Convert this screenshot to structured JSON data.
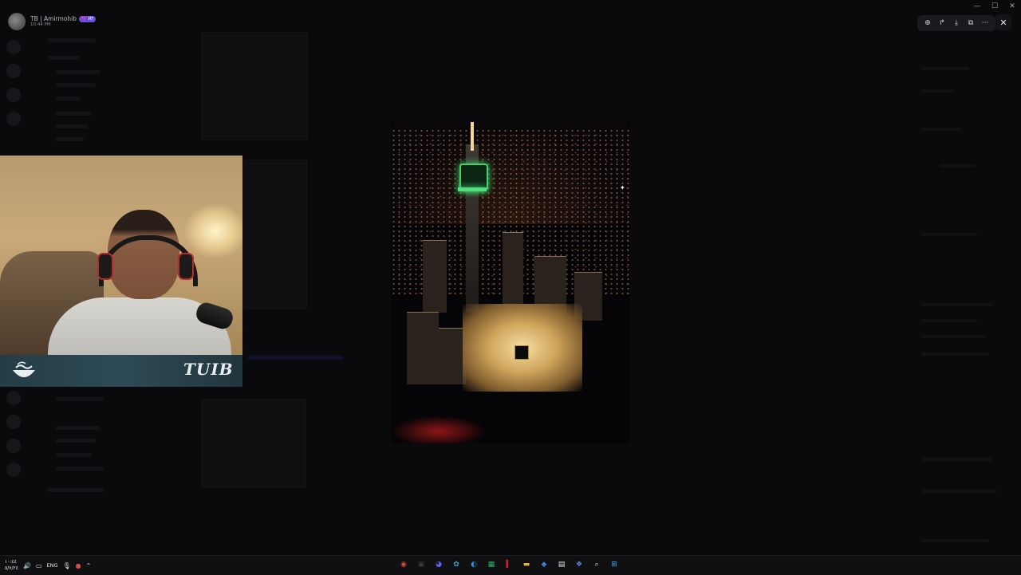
{
  "window": {
    "title": "",
    "controls": {
      "minimize": "—",
      "maximize": "☐",
      "close": "✕"
    }
  },
  "viewer": {
    "user": "TB | Amirmohib",
    "badge": "💜 RT",
    "time": "10:44 PM",
    "toolbar": {
      "zoom": "⊕",
      "forward": "↱",
      "download": "⤓",
      "open": "⧉",
      "more": "···"
    },
    "close": "✕"
  },
  "webcam": {
    "brand": "TUIB"
  },
  "photo": {
    "cursor": "✦"
  },
  "taskbar": {
    "clock_time": "١٠:٤٤",
    "clock_date": "٥/٧/٢٤",
    "language": "ENG",
    "tray_icons": {
      "speaker": "🔊",
      "network": "▭",
      "mic": "🎙",
      "chevron": "⌃"
    },
    "apps": [
      {
        "name": "app-1",
        "glyph": "◉",
        "color": "#d94b3c"
      },
      {
        "name": "app-2",
        "glyph": "▣",
        "color": "#3a3a40"
      },
      {
        "name": "discord",
        "glyph": "◕",
        "color": "#5865f2"
      },
      {
        "name": "app-4",
        "glyph": "✿",
        "color": "#4aa0d8"
      },
      {
        "name": "edge",
        "glyph": "◐",
        "color": "#1c8fd6"
      },
      {
        "name": "app-6",
        "glyph": "▦",
        "color": "#2fb170"
      },
      {
        "name": "app-7",
        "glyph": "▍",
        "color": "#cc1f2f"
      },
      {
        "name": "folder",
        "glyph": "▬",
        "color": "#e7b53c"
      },
      {
        "name": "app-9",
        "glyph": "◆",
        "color": "#3d7fe0"
      },
      {
        "name": "calendar",
        "glyph": "▤",
        "color": "#e8e8e8"
      },
      {
        "name": "app-11",
        "glyph": "❖",
        "color": "#5b8ef0"
      },
      {
        "name": "search",
        "glyph": "⌕",
        "color": "#e0e0e0"
      },
      {
        "name": "start",
        "glyph": "⊞",
        "color": "#3ea4f0"
      }
    ]
  }
}
